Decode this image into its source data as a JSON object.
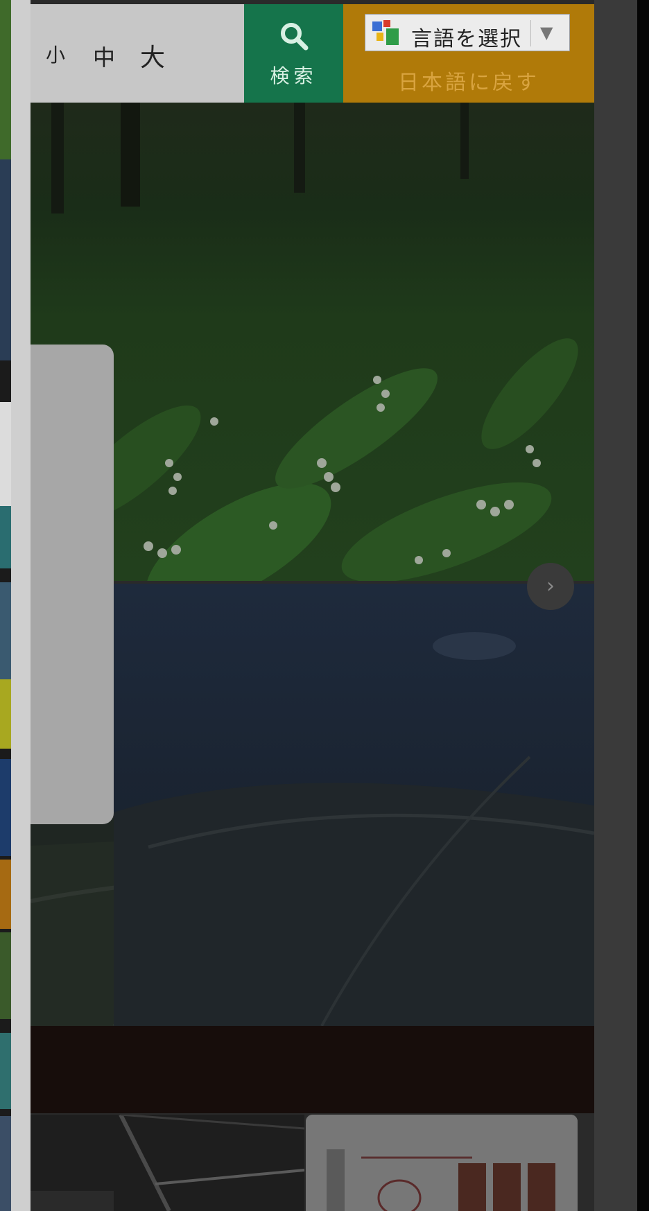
{
  "header": {
    "font_size": {
      "small": "小",
      "medium": "中",
      "large": "大"
    },
    "search": {
      "label": "検索",
      "icon": "search-icon"
    },
    "language": {
      "select_label": "言語を選択",
      "reset_label": "日本語に戻す",
      "icon": "google-translate-icon"
    }
  },
  "colors": {
    "search_green": "#15744b",
    "language_orange": "#b07a09",
    "overlay_dark": "#2a2a2a"
  },
  "hero": {
    "slide_images": [
      "lily-of-the-valley-field",
      "aerial-town-view"
    ],
    "next_icon": "arrow-right-icon"
  },
  "thumbnails": [
    "bridge-photo",
    "tomato-juice-product"
  ]
}
